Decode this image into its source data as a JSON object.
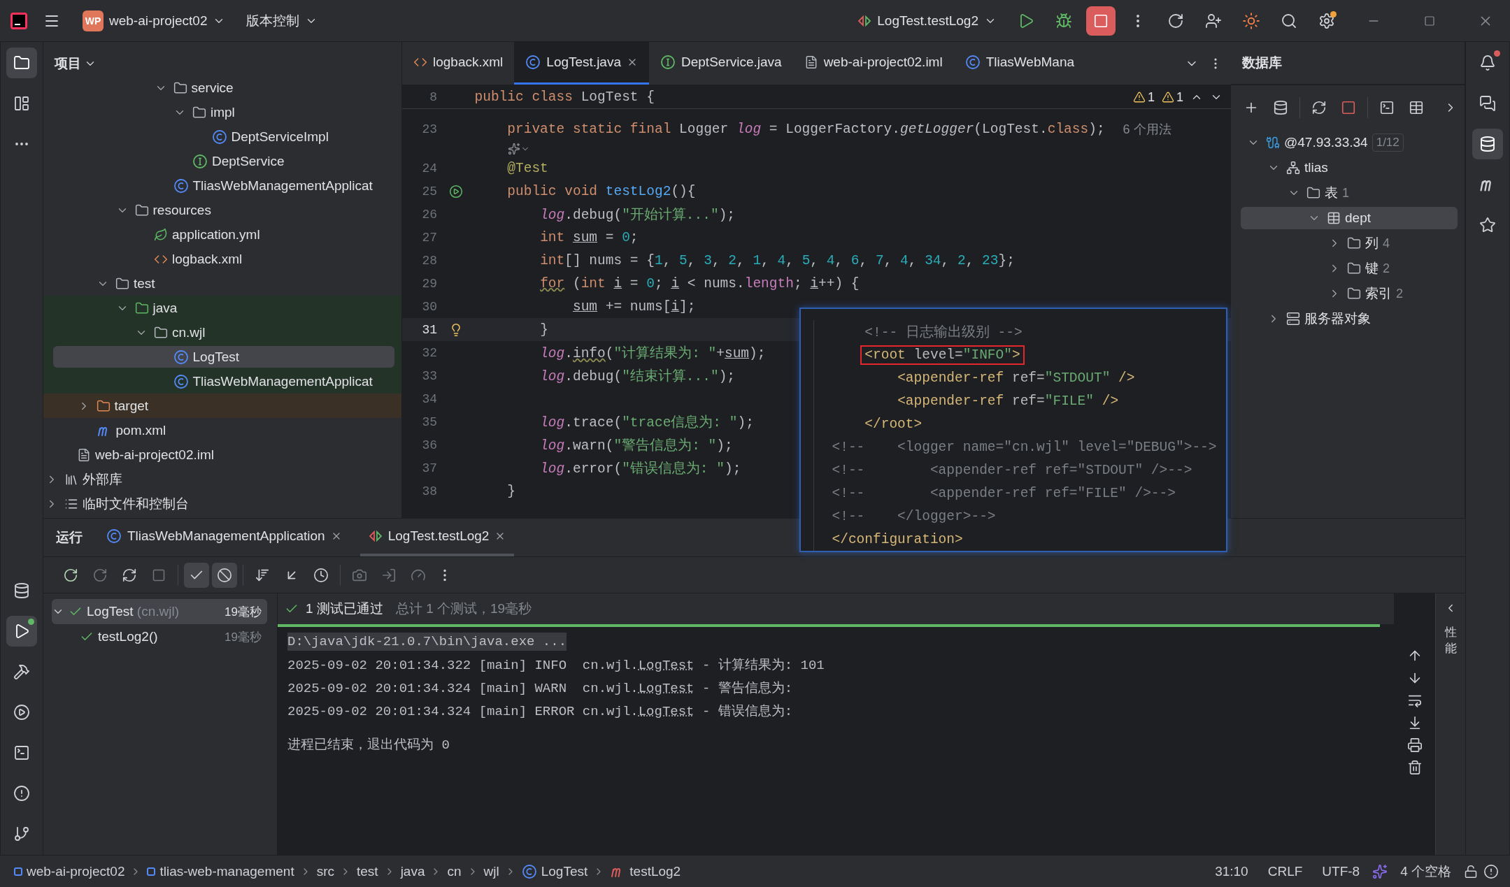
{
  "title_bar": {
    "project": {
      "badge": "WP",
      "name": "web-ai-project02"
    },
    "vcs": "版本控制",
    "run_config": "LogTest.testLog2"
  },
  "left_strip": {
    "top": [
      {
        "kind": "project",
        "selected": true
      },
      {
        "kind": "structure",
        "selected": false
      },
      {
        "kind": "more",
        "selected": false
      }
    ],
    "bottom": [
      {
        "kind": "database",
        "selected": false
      },
      {
        "kind": "run",
        "selected": true
      },
      {
        "kind": "build",
        "selected": false
      },
      {
        "kind": "services",
        "selected": false
      },
      {
        "kind": "terminal",
        "selected": false
      },
      {
        "kind": "problems",
        "selected": false
      },
      {
        "kind": "git",
        "selected": false
      }
    ]
  },
  "project_panel": {
    "title": "项目",
    "tree": [
      {
        "children": [
          {
            "children": [
              {
                "children": [
                  {
                    "children": [
                      {
                        "children": [
                          {
                            "children": [
                              {
                                "label": "service",
                                "kind": "package",
                                "expanded": true,
                                "selected": false,
                                "children": [
                                  {
                                    "label": "impl",
                                    "kind": "package",
                                    "expanded": true,
                                    "selected": false,
                                    "children": [
                                      {
                                        "label": "DeptServiceImpl",
                                        "kind": "class",
                                        "selected": false
                                      }
                                    ]
                                  },
                                  {
                                    "label": "DeptService",
                                    "kind": "interface",
                                    "selected": false
                                  }
                                ]
                              },
                              {
                                "label": "TliasWebManagementApplicat",
                                "kind": "spring-class",
                                "selected": false
                              }
                            ]
                          }
                        ]
                      },
                      {
                        "label": "resources",
                        "kind": "resources",
                        "expanded": true,
                        "selected": false,
                        "children": [
                          {
                            "label": "application.yml",
                            "kind": "yml",
                            "selected": false
                          },
                          {
                            "label": "logback.xml",
                            "kind": "xml",
                            "selected": false
                          }
                        ]
                      }
                    ]
                  },
                  {
                    "label": "test",
                    "kind": "folder",
                    "expanded": true,
                    "selected": false,
                    "children": [
                      {
                        "label": "java",
                        "kind": "test-root",
                        "expanded": true,
                        "selected": false,
                        "children": [
                          {
                            "label": "cn.wjl",
                            "kind": "package",
                            "expanded": true,
                            "selected": false,
                            "children": [
                              {
                                "label": "LogTest",
                                "kind": "test-class",
                                "selected": true
                              },
                              {
                                "label": "TliasWebManagementApplicat",
                                "kind": "test-class",
                                "selected": false
                              }
                            ]
                          }
                        ]
                      }
                    ]
                  }
                ]
              },
              {
                "label": "target",
                "kind": "excluded",
                "expanded": false,
                "selected": false
              },
              {
                "label": "pom.xml",
                "kind": "m-file",
                "selected": false
              }
            ]
          },
          {
            "label": "web-ai-project02.iml",
            "kind": "iml",
            "selected": false
          }
        ]
      },
      {
        "label": "外部库",
        "kind": "library",
        "expanded": false,
        "selected": false
      },
      {
        "label": "临时文件和控制台",
        "kind": "scratch",
        "expanded": false,
        "selected": false
      }
    ]
  },
  "editor": {
    "tabs": [
      {
        "label": "logback.xml",
        "kind": "xml",
        "selected": false
      },
      {
        "label": "LogTest.java",
        "kind": "test-class",
        "selected": true
      },
      {
        "label": "DeptService.java",
        "kind": "interface",
        "selected": false
      },
      {
        "label": "web-ai-project02.iml",
        "kind": "iml",
        "selected": false
      },
      {
        "label": "TliasWebMana",
        "kind": "spring-class",
        "selected": false
      }
    ],
    "warnings": [
      "1",
      "1"
    ],
    "sticky": {
      "no": "8",
      "tokens": [
        {
          "text": "public class ",
          "kind": "kw"
        },
        {
          "text": "LogTest {",
          "kind": "plain"
        }
      ]
    },
    "lines": [
      {
        "kind": "code",
        "no": "23",
        "current": false,
        "tokens": [
          {
            "text": "    private static final ",
            "kind": "kw"
          },
          {
            "text": "Logger ",
            "kind": "plain"
          },
          {
            "text": "log",
            "kind": "field"
          },
          {
            "text": " = LoggerFactory.",
            "kind": "plain"
          },
          {
            "text": "getLogger",
            "kind": "static"
          },
          {
            "text": "(LogTest.",
            "kind": "plain"
          },
          {
            "text": "class",
            "kind": "kw"
          },
          {
            "text": ");",
            "kind": "plain"
          }
        ],
        "hint": "6 个用法"
      },
      {
        "kind": "inlay",
        "current": false
      },
      {
        "kind": "code",
        "no": "24",
        "current": false,
        "tokens": [
          {
            "text": "    @Test",
            "kind": "ann"
          }
        ]
      },
      {
        "kind": "code",
        "no": "25",
        "current": false,
        "gutter": {
          "kind": "run"
        },
        "tokens": [
          {
            "text": "    public void ",
            "kind": "kw"
          },
          {
            "text": "testLog2",
            "kind": "fn"
          },
          {
            "text": "(){",
            "kind": "plain"
          }
        ]
      },
      {
        "kind": "code",
        "no": "26",
        "current": false,
        "tokens": [
          {
            "text": "        log",
            "kind": "field"
          },
          {
            "text": ".debug(",
            "kind": "plain"
          },
          {
            "text": "\"开始计算...\"",
            "kind": "str"
          },
          {
            "text": ");",
            "kind": "plain"
          }
        ]
      },
      {
        "kind": "code",
        "no": "27",
        "current": false,
        "tokens": [
          {
            "text": "        int ",
            "kind": "kw"
          },
          {
            "text": "sum",
            "kind": "reassigned"
          },
          {
            "text": " = ",
            "kind": "plain"
          },
          {
            "text": "0",
            "kind": "num"
          },
          {
            "text": ";",
            "kind": "plain"
          }
        ]
      },
      {
        "kind": "code",
        "no": "28",
        "current": false,
        "tokens": [
          {
            "text": "        int",
            "kind": "kw"
          },
          {
            "text": "[] nums = {",
            "kind": "plain"
          },
          {
            "text": "1",
            "kind": "num"
          },
          {
            "text": ", ",
            "kind": "plain"
          },
          {
            "text": "5",
            "kind": "num"
          },
          {
            "text": ", ",
            "kind": "plain"
          },
          {
            "text": "3",
            "kind": "num"
          },
          {
            "text": ", ",
            "kind": "plain"
          },
          {
            "text": "2",
            "kind": "num"
          },
          {
            "text": ", ",
            "kind": "plain"
          },
          {
            "text": "1",
            "kind": "num"
          },
          {
            "text": ", ",
            "kind": "plain"
          },
          {
            "text": "4",
            "kind": "num"
          },
          {
            "text": ", ",
            "kind": "plain"
          },
          {
            "text": "5",
            "kind": "num"
          },
          {
            "text": ", ",
            "kind": "plain"
          },
          {
            "text": "4",
            "kind": "num"
          },
          {
            "text": ", ",
            "kind": "plain"
          },
          {
            "text": "6",
            "kind": "num"
          },
          {
            "text": ", ",
            "kind": "plain"
          },
          {
            "text": "7",
            "kind": "num"
          },
          {
            "text": ", ",
            "kind": "plain"
          },
          {
            "text": "4",
            "kind": "num"
          },
          {
            "text": ", ",
            "kind": "plain"
          },
          {
            "text": "34",
            "kind": "num"
          },
          {
            "text": ", ",
            "kind": "plain"
          },
          {
            "text": "2",
            "kind": "num"
          },
          {
            "text": ", ",
            "kind": "plain"
          },
          {
            "text": "23",
            "kind": "num"
          },
          {
            "text": "};",
            "kind": "plain"
          }
        ]
      },
      {
        "kind": "code",
        "no": "29",
        "current": false,
        "tokens": [
          {
            "text": "        for",
            "kind": "kw-warn"
          },
          {
            "text": " (",
            "kind": "plain"
          },
          {
            "text": "int ",
            "kind": "kw"
          },
          {
            "text": "i",
            "kind": "reassigned"
          },
          {
            "text": " = ",
            "kind": "plain"
          },
          {
            "text": "0",
            "kind": "num"
          },
          {
            "text": "; ",
            "kind": "plain"
          },
          {
            "text": "i",
            "kind": "reassigned"
          },
          {
            "text": " < nums.",
            "kind": "plain"
          },
          {
            "text": "length",
            "kind": "member"
          },
          {
            "text": "; ",
            "kind": "plain"
          },
          {
            "text": "i",
            "kind": "reassigned"
          },
          {
            "text": "++) {",
            "kind": "plain"
          }
        ]
      },
      {
        "kind": "code",
        "no": "30",
        "current": false,
        "tokens": [
          {
            "text": "            sum",
            "kind": "reassigned"
          },
          {
            "text": " += nums[",
            "kind": "plain"
          },
          {
            "text": "i",
            "kind": "reassigned"
          },
          {
            "text": "];",
            "kind": "plain"
          }
        ]
      },
      {
        "kind": "code",
        "no": "31",
        "current": true,
        "gutter": {
          "kind": "bulb"
        },
        "tokens": [
          {
            "text": "        }",
            "kind": "plain"
          }
        ]
      },
      {
        "kind": "code",
        "no": "32",
        "current": false,
        "tokens": [
          {
            "text": "        log",
            "kind": "field"
          },
          {
            "text": ".",
            "kind": "plain"
          },
          {
            "text": "info",
            "kind": "warn"
          },
          {
            "text": "(",
            "kind": "plain"
          },
          {
            "text": "\"计算结果为: \"",
            "kind": "str"
          },
          {
            "text": "+",
            "kind": "plain"
          },
          {
            "text": "sum",
            "kind": "reassigned"
          },
          {
            "text": ");",
            "kind": "plain"
          }
        ]
      },
      {
        "kind": "code",
        "no": "33",
        "current": false,
        "tokens": [
          {
            "text": "        log",
            "kind": "field"
          },
          {
            "text": ".debug(",
            "kind": "plain"
          },
          {
            "text": "\"结束计算...\"",
            "kind": "str"
          },
          {
            "text": ");",
            "kind": "plain"
          }
        ]
      },
      {
        "kind": "code",
        "no": "34",
        "current": false
      },
      {
        "kind": "code",
        "no": "35",
        "current": false,
        "tokens": [
          {
            "text": "        log",
            "kind": "field"
          },
          {
            "text": ".trace(",
            "kind": "plain"
          },
          {
            "text": "\"trace信息为: \"",
            "kind": "str"
          },
          {
            "text": ");",
            "kind": "plain"
          }
        ]
      },
      {
        "kind": "code",
        "no": "36",
        "current": false,
        "tokens": [
          {
            "text": "        log",
            "kind": "field"
          },
          {
            "text": ".warn(",
            "kind": "plain"
          },
          {
            "text": "\"警告信息为: \"",
            "kind": "str"
          },
          {
            "text": ");",
            "kind": "plain"
          }
        ]
      },
      {
        "kind": "code",
        "no": "37",
        "current": false,
        "tokens": [
          {
            "text": "        log",
            "kind": "field"
          },
          {
            "text": ".error(",
            "kind": "plain"
          },
          {
            "text": "\"错误信息为: \"",
            "kind": "str"
          },
          {
            "text": ");",
            "kind": "plain"
          }
        ]
      },
      {
        "kind": "code",
        "no": "38",
        "current": false,
        "tokens": [
          {
            "text": "    }",
            "kind": "plain"
          }
        ]
      }
    ],
    "popup": [
      {
        "boxed": false,
        "tokens": [
          {
            "text": "    <!-- 日志输出级别 -->",
            "kind": "cmt"
          }
        ]
      },
      {
        "boxed": true,
        "tokens": [
          {
            "text": "    <root",
            "kind": "tag"
          },
          {
            "text": " level=",
            "kind": "attr"
          },
          {
            "text": "\"INFO\"",
            "kind": "val"
          },
          {
            "text": ">",
            "kind": "tag"
          }
        ]
      },
      {
        "boxed": false,
        "tokens": [
          {
            "text": "        <appender-ref",
            "kind": "tag"
          },
          {
            "text": " ref=",
            "kind": "attr"
          },
          {
            "text": "\"STDOUT\"",
            "kind": "val"
          },
          {
            "text": " />",
            "kind": "tag"
          }
        ]
      },
      {
        "boxed": false,
        "tokens": [
          {
            "text": "        <appender-ref",
            "kind": "tag"
          },
          {
            "text": " ref=",
            "kind": "attr"
          },
          {
            "text": "\"FILE\"",
            "kind": "val"
          },
          {
            "text": " />",
            "kind": "tag"
          }
        ]
      },
      {
        "boxed": false,
        "tokens": [
          {
            "text": "    </root>",
            "kind": "tag"
          }
        ]
      },
      {
        "boxed": false,
        "tokens": [
          {
            "text": "<!--    <logger name=\"cn.wjl\" level=\"DEBUG\">-->",
            "kind": "cmt"
          }
        ]
      },
      {
        "boxed": false,
        "tokens": [
          {
            "text": "<!--        <appender-ref ref=\"STDOUT\" />-->",
            "kind": "cmt"
          }
        ]
      },
      {
        "boxed": false,
        "tokens": [
          {
            "text": "<!--        <appender-ref ref=\"FILE\" />-->",
            "kind": "cmt"
          }
        ]
      },
      {
        "boxed": false,
        "tokens": [
          {
            "text": "<!--    </logger>-->",
            "kind": "cmt"
          }
        ]
      },
      {
        "boxed": false,
        "tokens": [
          {
            "text": "</configuration>",
            "kind": "tag"
          }
        ]
      }
    ]
  },
  "database_panel": {
    "title": "数据库",
    "tree": [
      {
        "label": "@47.93.33.34",
        "badge": "1/12",
        "kind": "connection",
        "expanded": true,
        "selected": false,
        "children": [
          {
            "label": "tlias",
            "kind": "schema",
            "expanded": true,
            "selected": false,
            "children": [
              {
                "label": "表",
                "count": "1",
                "kind": "folder",
                "expanded": true,
                "selected": false,
                "children": [
                  {
                    "label": "dept",
                    "kind": "table",
                    "expanded": true,
                    "selected": true,
                    "children": [
                      {
                        "label": "列",
                        "count": "4",
                        "kind": "folder",
                        "expanded": false,
                        "selected": false
                      },
                      {
                        "label": "键",
                        "count": "2",
                        "kind": "folder",
                        "expanded": false,
                        "selected": false
                      },
                      {
                        "label": "索引",
                        "count": "2",
                        "kind": "folder",
                        "expanded": false,
                        "selected": false
                      }
                    ]
                  }
                ]
              }
            ]
          },
          {
            "label": "服务器对象",
            "kind": "server",
            "expanded": false,
            "selected": false
          }
        ]
      }
    ]
  },
  "right_strip": [
    {
      "kind": "notifications",
      "selected": false
    },
    {
      "kind": "ai-chat",
      "selected": false
    },
    {
      "kind": "database",
      "selected": true
    },
    {
      "kind": "m-tool",
      "selected": false
    },
    {
      "kind": "plugin",
      "selected": false
    }
  ],
  "run_panel": {
    "title": "运行",
    "tabs": [
      {
        "label": "TliasWebManagementApplication",
        "kind": "spring-class",
        "selected": false
      },
      {
        "label": "LogTest.testLog2",
        "kind": "test",
        "selected": true
      }
    ],
    "filters": {
      "show_passed": true,
      "show_ignored": true
    },
    "tests": [
      {
        "label": "LogTest",
        "detail": "(cn.wjl)",
        "time": "19毫秒",
        "passed": true,
        "expanded": true,
        "selected": true,
        "children": [
          {
            "label": "testLog2()",
            "time": "19毫秒",
            "passed": true,
            "selected": false
          }
        ]
      }
    ],
    "summary": {
      "status": "1 测试已通过",
      "detail": "总计 1 个测试，19毫秒",
      "level": 1
    },
    "console": [
      {
        "kind": "command",
        "text": "D:\\java\\jdk-21.0.7\\bin\\java.exe ..."
      },
      {
        "kind": "log",
        "prefix": "2025-09-02 20:01:34.322 [main] INFO  cn.wjl.",
        "link": "LogTest",
        "suffix": " - 计算结果为: 101"
      },
      {
        "kind": "log",
        "prefix": "2025-09-02 20:01:34.324 [main] WARN  cn.wjl.",
        "link": "LogTest",
        "suffix": " - 警告信息为:"
      },
      {
        "kind": "log",
        "prefix": "2025-09-02 20:01:34.324 [main] ERROR cn.wjl.",
        "link": "LogTest",
        "suffix": " - 错误信息为:"
      },
      {
        "kind": "exit",
        "text": "进程已结束，退出代码为 0"
      }
    ],
    "side_label": "性能"
  },
  "status_bar": {
    "breadcrumbs": [
      {
        "label": "web-ai-project02",
        "kind": "module"
      },
      {
        "label": "tlias-web-management",
        "kind": "module"
      },
      {
        "label": "src",
        "kind": "dir"
      },
      {
        "label": "test",
        "kind": "dir"
      },
      {
        "label": "java",
        "kind": "dir"
      },
      {
        "label": "cn",
        "kind": "dir"
      },
      {
        "label": "wjl",
        "kind": "dir"
      },
      {
        "label": "LogTest",
        "kind": "class"
      },
      {
        "label": "testLog2",
        "kind": "method"
      }
    ],
    "position": "31:10",
    "line_separator": "CRLF",
    "encoding": "UTF-8",
    "indent": "4 个空格"
  }
}
